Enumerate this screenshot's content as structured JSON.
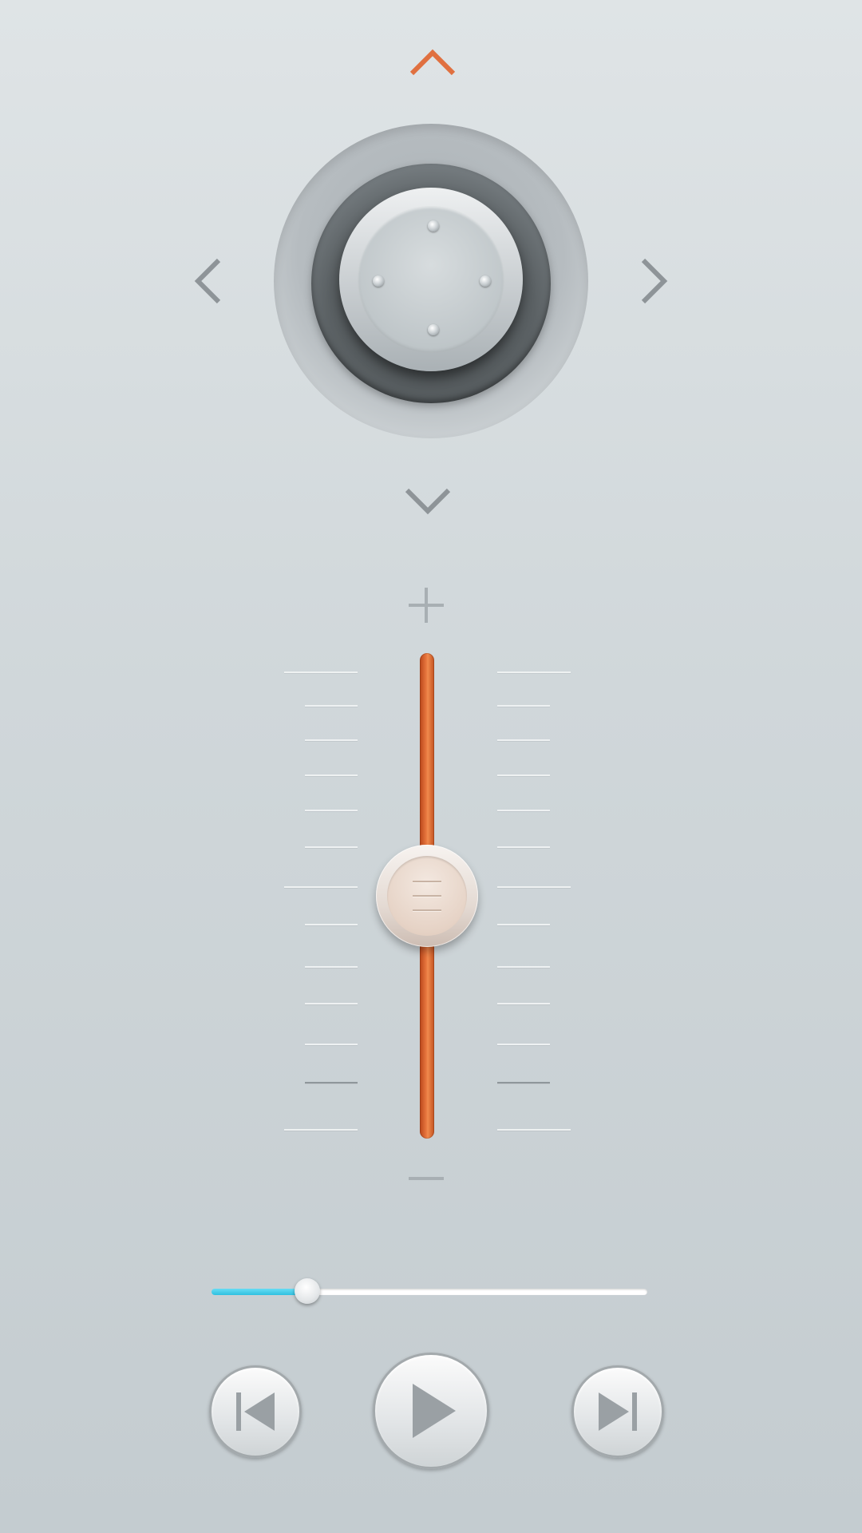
{
  "dpad": {
    "up_icon": "chevron-up-icon",
    "down_icon": "chevron-down-icon",
    "left_icon": "chevron-left-icon",
    "right_icon": "chevron-right-icon",
    "active_direction": "up"
  },
  "volume": {
    "increase_icon": "plus-icon",
    "decrease_icon": "minus-icon",
    "level_fraction": 0.5
  },
  "playback": {
    "progress_fraction": 0.22,
    "previous_icon": "skip-previous-icon",
    "play_icon": "play-icon",
    "next_icon": "skip-next-icon"
  },
  "colors": {
    "accent": "#e07040",
    "progress": "#3fc8e6",
    "inactive_icon": "#8e9498"
  }
}
